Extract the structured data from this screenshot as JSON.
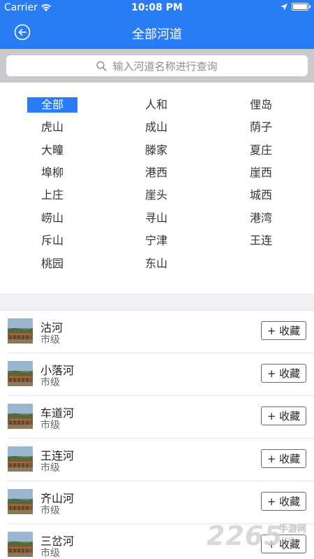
{
  "status_bar": {
    "carrier": "Carrier",
    "time": "10:08 PM"
  },
  "nav": {
    "title": "全部河道",
    "back_icon": "back-arrow-circle-icon"
  },
  "search": {
    "placeholder": "输入河道名称进行查询"
  },
  "districts": {
    "selected": "全部",
    "columns": [
      [
        "全部",
        "虎山",
        "大疃",
        "埠柳",
        "上庄",
        "崂山",
        "斥山",
        "桃园"
      ],
      [
        "人和",
        "成山",
        "滕家",
        "港西",
        "崖头",
        "寻山",
        "宁津",
        "东山"
      ],
      [
        "俚岛",
        "荫子",
        "夏庄",
        "崖西",
        "城西",
        "港湾",
        "王连"
      ]
    ]
  },
  "rivers": [
    {
      "name": "沽河",
      "level": "市级",
      "action": "+ 收藏"
    },
    {
      "name": "小落河",
      "level": "市级",
      "action": "+ 收藏"
    },
    {
      "name": "车道河",
      "level": "市级",
      "action": "+ 收藏"
    },
    {
      "name": "王连河",
      "level": "市级",
      "action": "+ 收藏"
    },
    {
      "name": "齐山河",
      "level": "市级",
      "action": "+ 收藏"
    },
    {
      "name": "三岔河",
      "level": "市级",
      "action": "+ 收藏"
    }
  ],
  "watermark": {
    "number": "2265",
    "line1": "手游网",
    "line2": ".com"
  },
  "colors": {
    "accent": "#2a7cf5",
    "band": "#efeff4",
    "search_bg": "#c9c9ce"
  }
}
